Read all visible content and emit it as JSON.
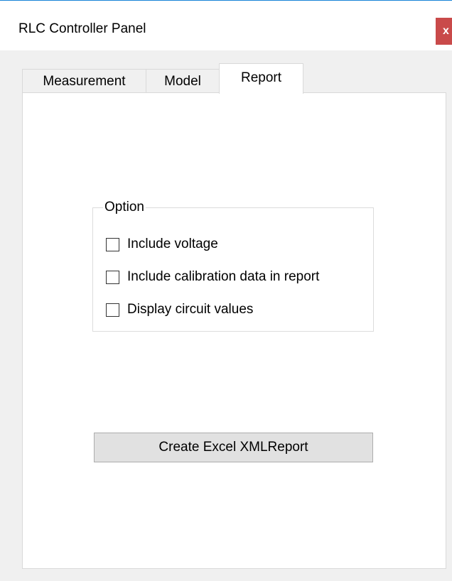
{
  "window": {
    "title": "RLC Controller Panel",
    "close_label": "x",
    "accent_color": "#1883d7",
    "close_color": "#c94a4a"
  },
  "tabs": [
    {
      "label": "Measurement",
      "selected": false
    },
    {
      "label": "Model",
      "selected": false
    },
    {
      "label": "Report",
      "selected": true
    }
  ],
  "report": {
    "option_group": {
      "legend": "Option",
      "items": [
        {
          "label": "Include voltage",
          "checked": false
        },
        {
          "label": "Include calibration data in report",
          "checked": false
        },
        {
          "label": "Display circuit values",
          "checked": false
        }
      ]
    },
    "create_button_label": "Create Excel XMLReport"
  }
}
